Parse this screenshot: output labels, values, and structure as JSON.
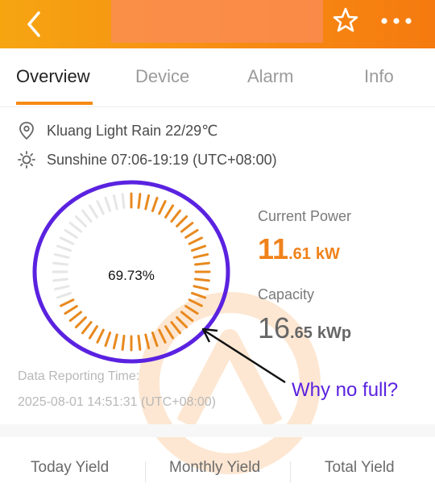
{
  "header": {
    "icons": {
      "back": "chevron-left-icon",
      "favorite": "star-outline-icon",
      "more": "more-dots-icon"
    },
    "colors": {
      "gradient_start": "#f6a511",
      "gradient_end": "#f57a0f"
    }
  },
  "tabs": [
    {
      "label": "Overview",
      "active": true
    },
    {
      "label": "Device",
      "active": false
    },
    {
      "label": "Alarm",
      "active": false
    },
    {
      "label": "Info",
      "active": false
    }
  ],
  "location": {
    "icon": "location-pin-icon",
    "text": "Kluang Light Rain 22/29℃"
  },
  "sunshine": {
    "icon": "sun-icon",
    "text": "Sunshine  07:06-19:19 (UTC+08:00)"
  },
  "gauge": {
    "percent_label": "69.73%",
    "fill_fraction": 0.6973,
    "accent": "#e8891e",
    "track": "#e6e6e6"
  },
  "current_power": {
    "label": "Current Power",
    "int": "11",
    "dec": ".61",
    "unit": "kW"
  },
  "capacity": {
    "label": "Capacity",
    "int": "16",
    "dec": ".65",
    "unit": "kWp"
  },
  "reporting": {
    "label": "Data Reporting Time:",
    "time": "2025-08-01 14:51:31 (UTC+08:00)"
  },
  "annotation": {
    "text": "Why no full?",
    "color": "#5a22e0"
  },
  "yields": [
    {
      "label": "Today Yield"
    },
    {
      "label": "Monthly Yield"
    },
    {
      "label": "Total Yield"
    }
  ]
}
